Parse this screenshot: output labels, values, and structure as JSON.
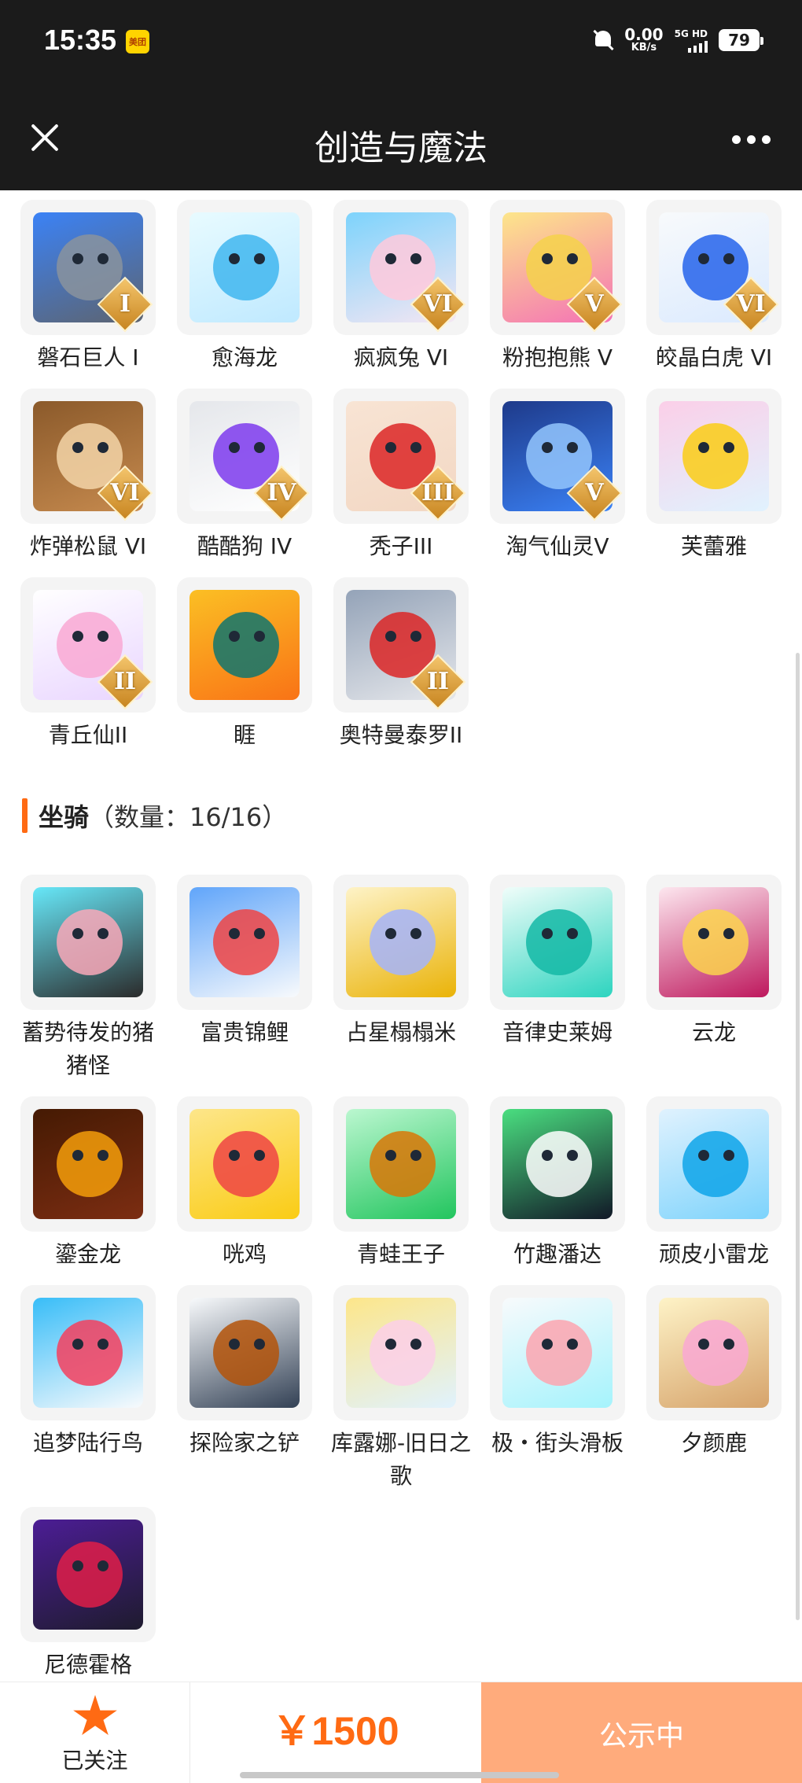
{
  "status_bar": {
    "time": "15:35",
    "app_badge": "美团",
    "net_speed_value": "0.00",
    "net_speed_unit": "KB/s",
    "network": "5G HD",
    "battery": "79"
  },
  "header": {
    "title": "创造与魔法"
  },
  "pets": [
    {
      "name": "磐石巨人 I",
      "tier": "I",
      "c1": "#5d6470",
      "c2": "#8a939e",
      "c3": "#3b82f6"
    },
    {
      "name": "愈海龙",
      "tier": "",
      "c1": "#bfe9ff",
      "c2": "#3fb6f0",
      "c3": "#e8fbff"
    },
    {
      "name": "疯疯兔 VI",
      "tier": "VI",
      "c1": "#f5e6f3",
      "c2": "#ffc9dc",
      "c3": "#7dd3fc"
    },
    {
      "name": "粉抱抱熊 V",
      "tier": "V",
      "c1": "#f472b6",
      "c2": "#f5d24a",
      "c3": "#fde68a"
    },
    {
      "name": "皎晶白虎 VI",
      "tier": "VI",
      "c1": "#dbeafe",
      "c2": "#2563eb",
      "c3": "#f8fafc"
    },
    {
      "name": "炸弹松鼠 VI",
      "tier": "VI",
      "c1": "#c68a4e",
      "c2": "#f3d5a8",
      "c3": "#8b5a2b"
    },
    {
      "name": "酷酷狗 IV",
      "tier": "IV",
      "c1": "#ffffff",
      "c2": "#7c3aed",
      "c3": "#e5e7eb"
    },
    {
      "name": "秃子III",
      "tier": "III",
      "c1": "#f2d7c3",
      "c2": "#dc2626",
      "c3": "#f8e4d4"
    },
    {
      "name": "淘气仙灵V",
      "tier": "V",
      "c1": "#3b82f6",
      "c2": "#93c5fd",
      "c3": "#1e3a8a"
    },
    {
      "name": "芙蕾雅",
      "tier": "",
      "c1": "#e0f2fe",
      "c2": "#facc15",
      "c3": "#fbcfe8"
    },
    {
      "name": "青丘仙II",
      "tier": "II",
      "c1": "#e9d5ff",
      "c2": "#f9a8d4",
      "c3": "#ffffff"
    },
    {
      "name": "睚",
      "tier": "",
      "c1": "#f97316",
      "c2": "#0f766e",
      "c3": "#fbbf24"
    },
    {
      "name": "奥特曼泰罗II",
      "tier": "II",
      "c1": "#e5e7eb",
      "c2": "#dc2626",
      "c3": "#94a3b8"
    }
  ],
  "mounts_section": {
    "title": "坐骑",
    "count": "（数量：16/16）"
  },
  "mounts": [
    {
      "name": "蓄势待发的猪猪怪",
      "c1": "#2b2b2b",
      "c2": "#f9a8b8",
      "c3": "#67e8f9"
    },
    {
      "name": "富贵锦鲤",
      "c1": "#f8fafc",
      "c2": "#ef4444",
      "c3": "#60a5fa"
    },
    {
      "name": "占星榻榻米",
      "c1": "#eab308",
      "c2": "#a5b4fc",
      "c3": "#fef3c7"
    },
    {
      "name": "音律史莱姆",
      "c1": "#2dd4bf",
      "c2": "#14b8a6",
      "c3": "#f0fdfa"
    },
    {
      "name": "云龙",
      "c1": "#be185d",
      "c2": "#fcd34d",
      "c3": "#fde7ef"
    },
    {
      "name": "鎏金龙",
      "c1": "#7c2d12",
      "c2": "#f59e0b",
      "c3": "#451a03"
    },
    {
      "name": "咣鸡",
      "c1": "#facc15",
      "c2": "#ef4444",
      "c3": "#fde68a"
    },
    {
      "name": "青蛙王子",
      "c1": "#22c55e",
      "c2": "#d97706",
      "c3": "#bbf7d0"
    },
    {
      "name": "竹趣潘达",
      "c1": "#111827",
      "c2": "#ffffff",
      "c3": "#4ade80"
    },
    {
      "name": "顽皮小雷龙",
      "c1": "#7dd3fc",
      "c2": "#0ea5e9",
      "c3": "#e0f2fe"
    },
    {
      "name": "追梦陆行鸟",
      "c1": "#f8fafc",
      "c2": "#f43f5e",
      "c3": "#38bdf8"
    },
    {
      "name": "探险家之铲",
      "c1": "#334155",
      "c2": "#b45309",
      "c3": "#f8fafc"
    },
    {
      "name": "库露娜-旧日之歌",
      "c1": "#e0f2fe",
      "c2": "#fbcfe8",
      "c3": "#fde68a"
    },
    {
      "name": "极・街头滑板",
      "c1": "#a5f3fc",
      "c2": "#fda4af",
      "c3": "#f8fafc"
    },
    {
      "name": "夕颜鹿",
      "c1": "#d6a36b",
      "c2": "#f9a8d4",
      "c3": "#fef3c7"
    },
    {
      "name": "尼德霍格",
      "c1": "#1e1b2e",
      "c2": "#e11d48",
      "c3": "#4c1d95"
    }
  ],
  "bottom_bar": {
    "follow_label": "已关注",
    "price": "￥1500",
    "status_button": "公示中"
  }
}
